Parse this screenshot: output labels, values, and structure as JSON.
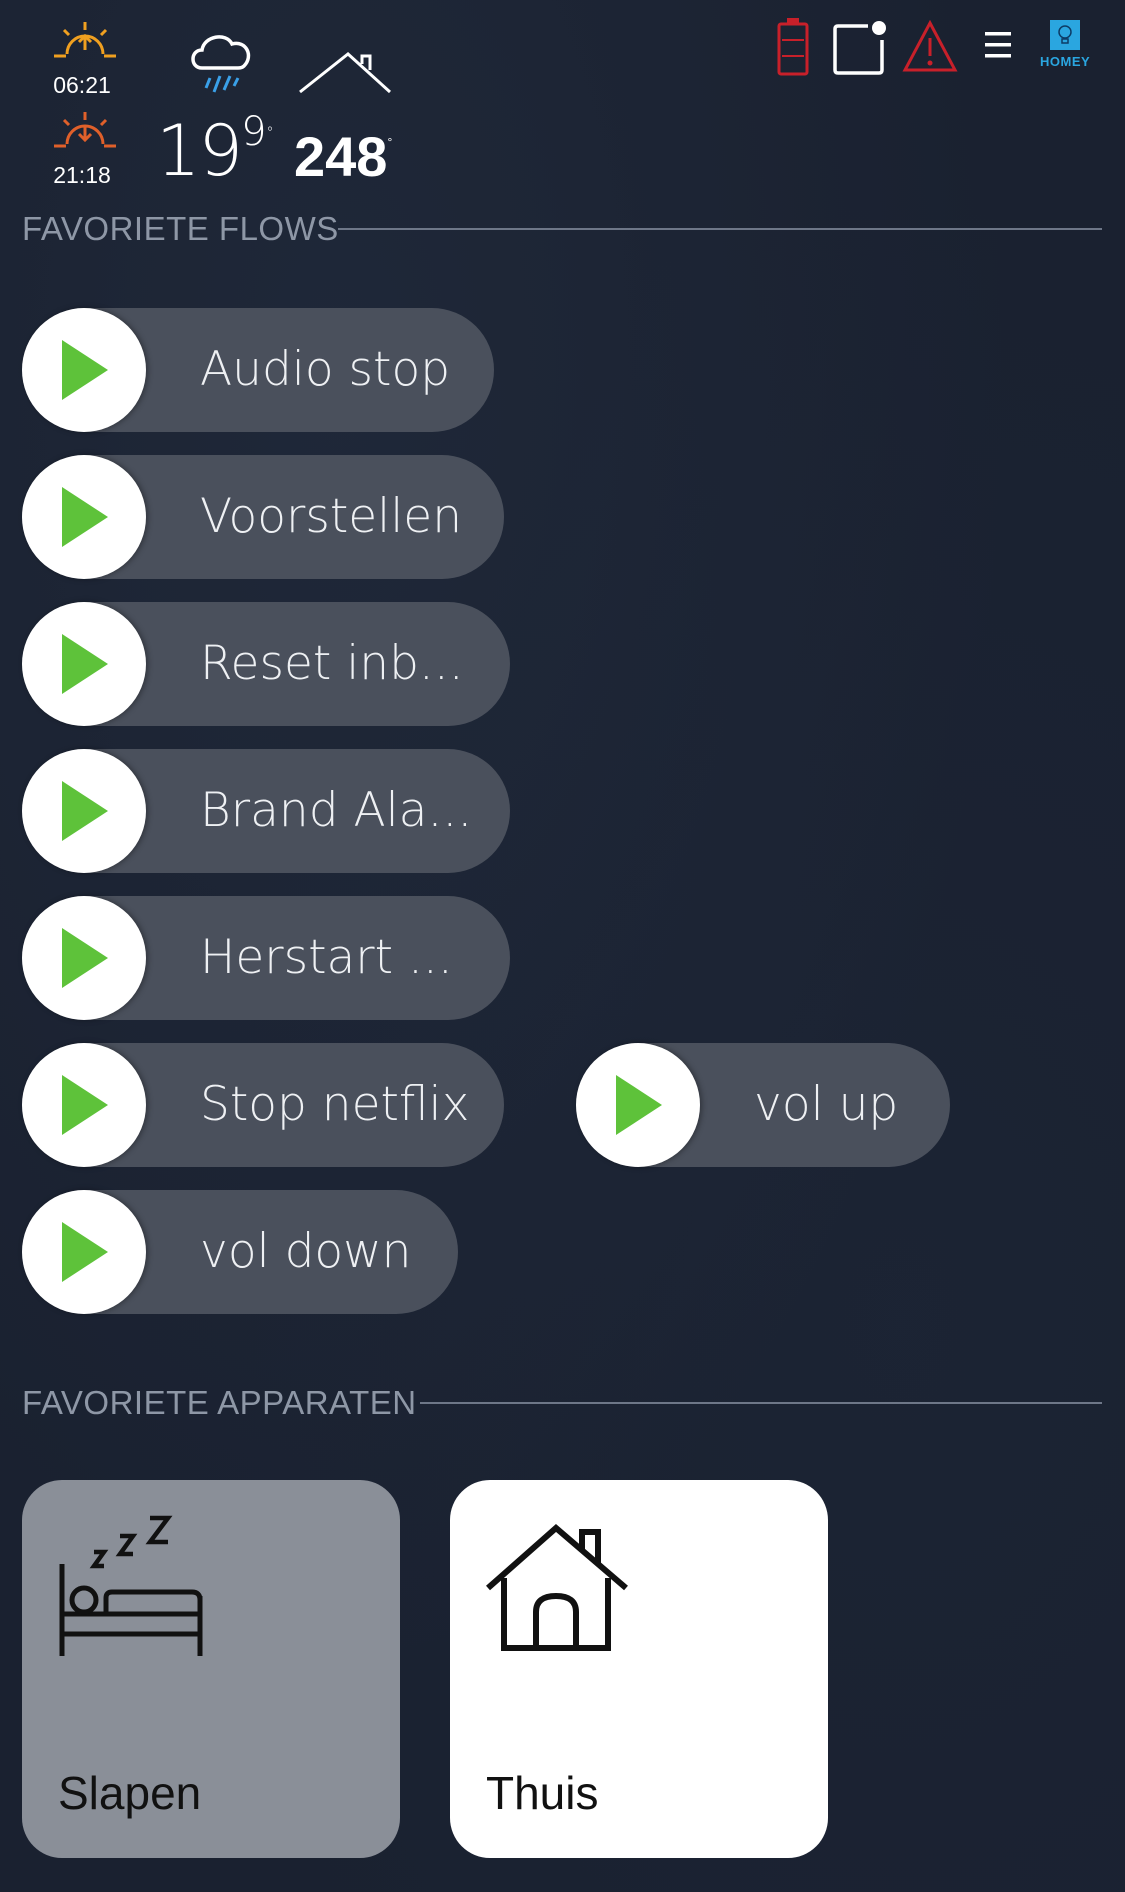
{
  "header": {
    "sunrise": "06:21",
    "sunset": "21:18",
    "outdoor_temp_whole": "19",
    "outdoor_temp_decimal": "9",
    "outdoor_temp_unit": "°",
    "indoor_temp": "248",
    "indoor_temp_unit": "°",
    "homey_label": "HOMEY"
  },
  "sections": {
    "flows_title": "FAVORIETE FLOWS",
    "devices_title": "FAVORIETE APPARATEN"
  },
  "flows": [
    {
      "label": "Audio stop"
    },
    {
      "label": "Voorstellen"
    },
    {
      "label": "Reset inb..."
    },
    {
      "label": "Brand Ala..."
    },
    {
      "label": "Herstart ..."
    },
    {
      "label": "Stop netflix"
    },
    {
      "label": "vol up"
    },
    {
      "label": "vol down"
    }
  ],
  "devices": [
    {
      "name": "Slapen",
      "icon": "bed-sleep-icon",
      "state": "off"
    },
    {
      "name": "Thuis",
      "icon": "house-icon",
      "state": "on"
    }
  ],
  "colors": {
    "accent_orange": "#f0a020",
    "alert_red": "#c8202a",
    "play_green": "#5ec23a",
    "homey_blue": "#2aa6e0",
    "tile_off": "#8a8f98",
    "tile_on": "#ffffff"
  }
}
